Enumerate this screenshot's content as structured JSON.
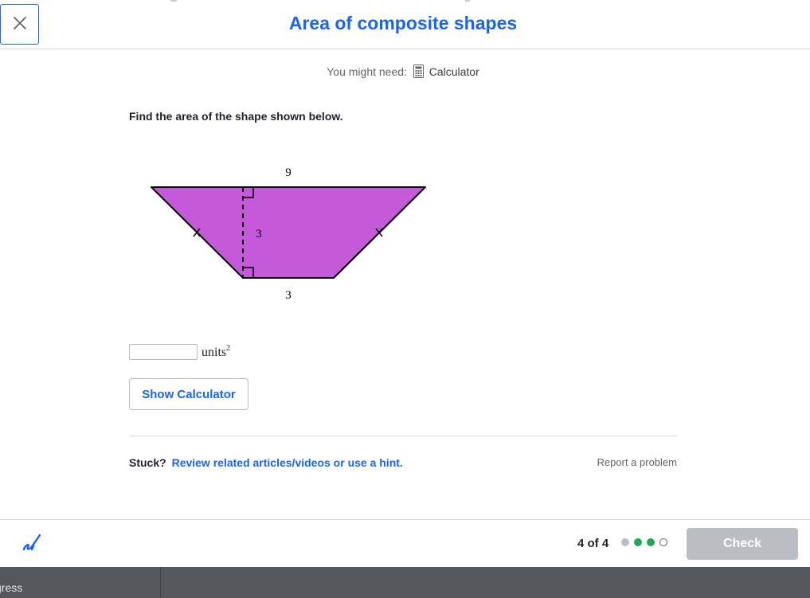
{
  "header": {
    "title": "Area of composite shapes",
    "close_icon": "close-icon"
  },
  "resources": {
    "label": "You might need:",
    "tool": "Calculator",
    "tool_icon": "calculator-icon"
  },
  "question": {
    "prompt": "Find the area of the shape shown below."
  },
  "figure": {
    "shape": "trapezoid",
    "fill_color": "#c45ad8",
    "top_base_label": "9",
    "height_label": "3",
    "bottom_base_label": "3"
  },
  "answer": {
    "value": "",
    "placeholder": "",
    "units": "units",
    "exponent": "2"
  },
  "buttons": {
    "show_calculator": "Show Calculator",
    "check": "Check"
  },
  "help": {
    "stuck_label": "Stuck?",
    "hint_link": "Review related articles/videos or use a hint.",
    "report": "Report a problem"
  },
  "footer": {
    "progress": "4 of 4",
    "scratchpad_icon": "scratchpad-icon",
    "dots": [
      {
        "state": "done",
        "color": "#babec2"
      },
      {
        "state": "correct",
        "color": "#1fab54"
      },
      {
        "state": "correct",
        "color": "#1fab54"
      },
      {
        "state": "current",
        "color": "#ffffff"
      }
    ]
  },
  "bottom_bar": {
    "text": "gress"
  },
  "colors": {
    "accent": "#1865f2",
    "correct": "#1fab54",
    "disabled": "#babec2"
  }
}
